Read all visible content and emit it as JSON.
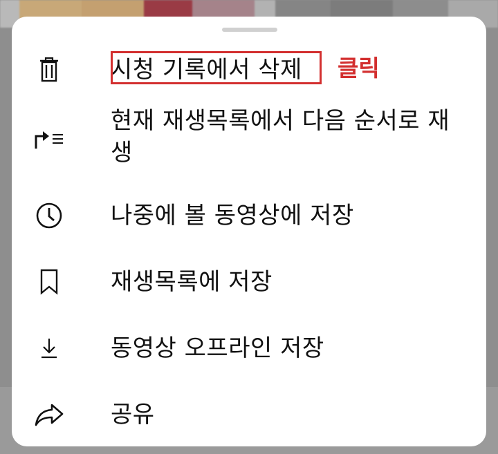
{
  "menu": {
    "items": [
      {
        "label": "시청 기록에서 삭제",
        "icon": "trash-icon"
      },
      {
        "label": "현재 재생목록에서 다음 순서로 재생",
        "icon": "play-next-icon"
      },
      {
        "label": "나중에 볼 동영상에 저장",
        "icon": "clock-icon"
      },
      {
        "label": "재생목록에 저장",
        "icon": "bookmark-icon"
      },
      {
        "label": "동영상 오프라인 저장",
        "icon": "download-icon"
      },
      {
        "label": "공유",
        "icon": "share-icon"
      }
    ]
  },
  "annotation": {
    "label": "클릭",
    "color": "#d32f2f"
  },
  "colors": {
    "text": "#111111",
    "sheet": "#ffffff",
    "backdrop": "#8e8e8e"
  }
}
